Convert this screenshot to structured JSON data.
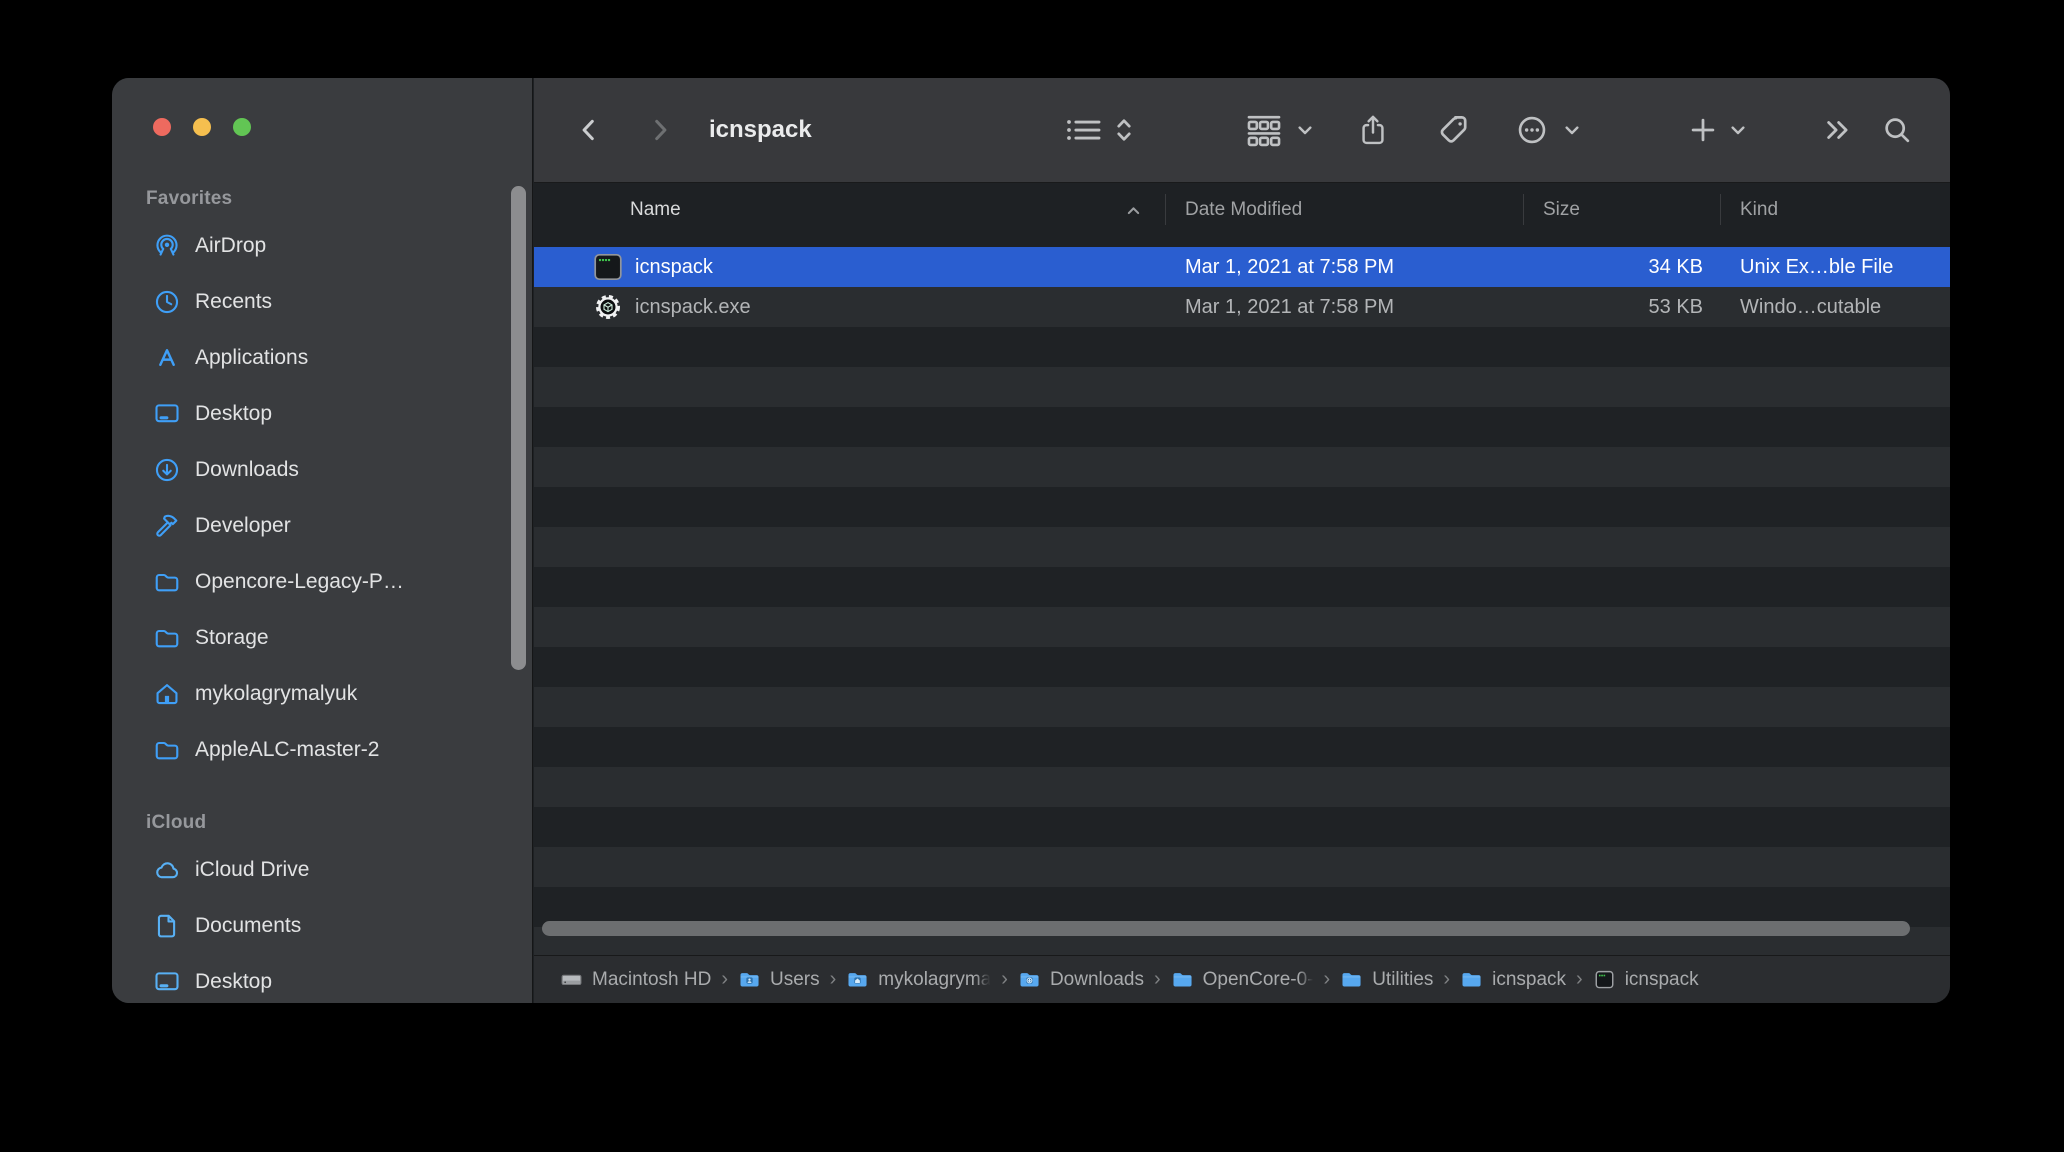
{
  "window": {
    "title": "icnspack"
  },
  "window_controls": {
    "close": "close",
    "minimize": "minimize",
    "zoom": "zoom"
  },
  "toolbar": {
    "buttons": [
      {
        "name": "back",
        "icon": "chevron-left"
      },
      {
        "name": "forward",
        "icon": "chevron-right"
      },
      {
        "name": "view-list",
        "icon": "list-view"
      },
      {
        "name": "view-arrange",
        "icon": "updown-chevrons"
      },
      {
        "name": "group-by",
        "icon": "group-view"
      },
      {
        "name": "group-by-menu",
        "icon": "chevron-down"
      },
      {
        "name": "share",
        "icon": "share"
      },
      {
        "name": "tags",
        "icon": "tag"
      },
      {
        "name": "more-actions",
        "icon": "more-ellipsis"
      },
      {
        "name": "more-actions-menu",
        "icon": "chevron-down"
      },
      {
        "name": "new-item",
        "icon": "plus"
      },
      {
        "name": "new-item-menu",
        "icon": "chevron-down"
      },
      {
        "name": "toolbar-overflow",
        "icon": "double-chevron"
      },
      {
        "name": "search",
        "icon": "search"
      }
    ]
  },
  "sidebar": {
    "sections": [
      {
        "label": "Favorites",
        "items": [
          {
            "icon": "airdrop",
            "label": "AirDrop"
          },
          {
            "icon": "clock",
            "label": "Recents"
          },
          {
            "icon": "appstore",
            "label": "Applications"
          },
          {
            "icon": "desktop",
            "label": "Desktop"
          },
          {
            "icon": "downloads",
            "label": "Downloads"
          },
          {
            "icon": "hammer",
            "label": "Developer"
          },
          {
            "icon": "folder",
            "label": "Opencore-Legacy-P…"
          },
          {
            "icon": "folder",
            "label": "Storage"
          },
          {
            "icon": "home",
            "label": "mykolagrymalyuk"
          },
          {
            "icon": "folder",
            "label": "AppleALC-master-2"
          }
        ]
      },
      {
        "label": "iCloud",
        "items": [
          {
            "icon": "cloud",
            "label": "iCloud Drive"
          },
          {
            "icon": "document",
            "label": "Documents"
          },
          {
            "icon": "desktop",
            "label": "Desktop"
          }
        ]
      }
    ]
  },
  "columns": [
    {
      "label": "Name",
      "sort": "ascending"
    },
    {
      "label": "Date Modified"
    },
    {
      "label": "Size"
    },
    {
      "label": "Kind"
    }
  ],
  "rows": [
    {
      "icon": "unix-executable",
      "name": "icnspack",
      "date_modified": "Mar 1, 2021 at 7:58 PM",
      "size": "34 KB",
      "kind": "Unix Ex…ble File",
      "selected": true
    },
    {
      "icon": "windows-executable",
      "name": "icnspack.exe",
      "date_modified": "Mar 1, 2021 at 7:58 PM",
      "size": "53 KB",
      "kind": "Windo…cutable",
      "selected": false
    }
  ],
  "path_bar": {
    "items": [
      {
        "icon": "hard-drive",
        "label": "Macintosh HD"
      },
      {
        "icon": "folder-users",
        "label": "Users"
      },
      {
        "icon": "folder-home",
        "label": "mykolagryma",
        "truncated": true
      },
      {
        "icon": "folder-downloads",
        "label": "Downloads"
      },
      {
        "icon": "folder-generic",
        "label": "OpenCore-0-",
        "truncated": true
      },
      {
        "icon": "folder-generic",
        "label": "Utilities"
      },
      {
        "icon": "folder-generic",
        "label": "icnspack"
      },
      {
        "icon": "unix-executable-small",
        "label": "icnspack"
      }
    ]
  },
  "colors": {
    "selection_blue": "#2a5ed0",
    "sidebar_icon_blue": "#3f9ff7",
    "icloud_icon_blue": "#58b0f4",
    "traffic_red": "#ee6a5f",
    "traffic_yellow": "#f5bf4f",
    "traffic_green": "#62c554",
    "sidebar_bg": "#3a3c3f",
    "toolbar_bg": "#38393c",
    "row_dark": "#1f2225",
    "row_light": "#2a2d30",
    "pathbar_bg": "#2b2d30"
  }
}
